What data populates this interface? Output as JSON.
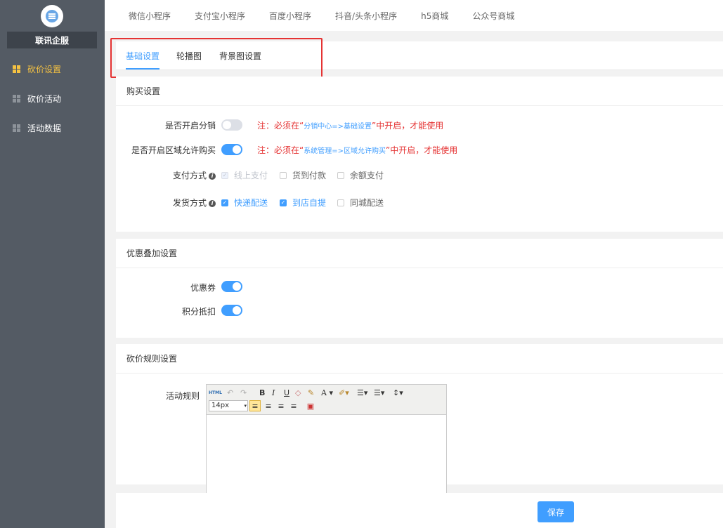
{
  "sidebar": {
    "brand": "联讯企服",
    "items": [
      {
        "label": "砍价设置",
        "active": true
      },
      {
        "label": "砍价活动",
        "active": false
      },
      {
        "label": "活动数据",
        "active": false
      }
    ]
  },
  "topnav": [
    "微信小程序",
    "支付宝小程序",
    "百度小程序",
    "抖音/头条小程序",
    "h5商城",
    "公众号商城"
  ],
  "tabs": [
    "基础设置",
    "轮播图",
    "背景图设置"
  ],
  "purchase": {
    "title": "购买设置",
    "distribution_label": "是否开启分销",
    "distribution_note_pre": "注：必须在“",
    "distribution_note_link": "分销中心=>基础设置",
    "distribution_note_post": "”中开启，才能使用",
    "region_label": "是否开启区域允许购买",
    "region_note_pre": "注：必须在“",
    "region_note_link": "系统管理=>区域允许购买",
    "region_note_post": "”中开启，才能使用",
    "pay_label": "支付方式",
    "pay_options": [
      "线上支付",
      "货到付款",
      "余额支付"
    ],
    "ship_label": "发货方式",
    "ship_options": [
      "快递配送",
      "到店自提",
      "同城配送"
    ]
  },
  "discount": {
    "title": "优惠叠加设置",
    "coupon_label": "优惠券",
    "points_label": "积分抵扣"
  },
  "rules": {
    "title": "砍价规则设置",
    "label": "活动规则",
    "font_size": "14px"
  },
  "save_label": "保存",
  "colors": {
    "accent": "#409eff",
    "active_menu": "#f5c242",
    "warning": "#e53333",
    "sidebar": "#545b64"
  }
}
